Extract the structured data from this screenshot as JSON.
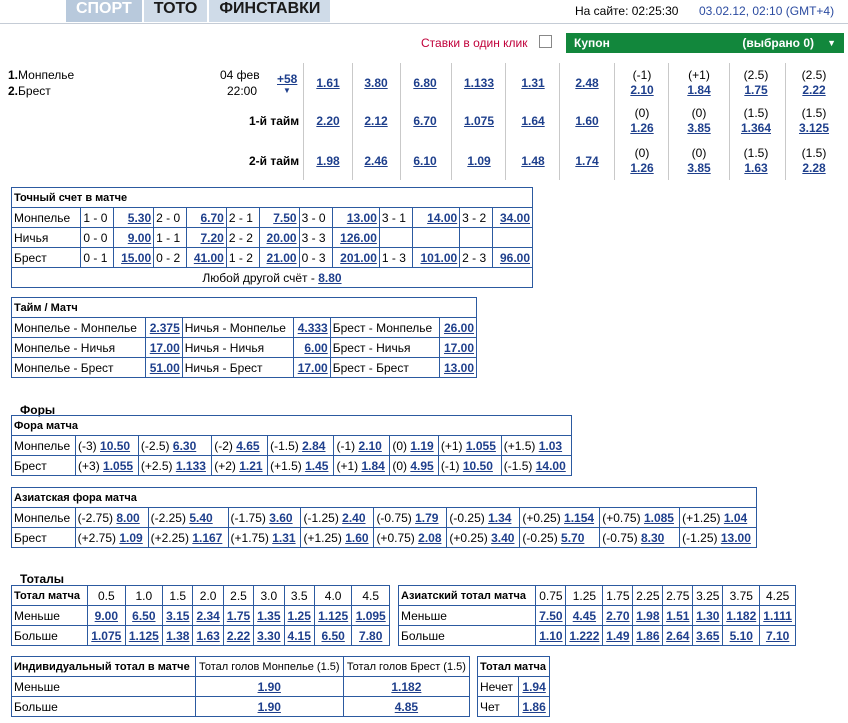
{
  "nav": {
    "items": [
      "СПОРТ",
      "ТОТО",
      "ФИНСТАВКИ"
    ]
  },
  "header": {
    "online": "На сайте: 02:25:30",
    "datetime": "03.02.12, 02:10 (GMT+4)"
  },
  "oneclick": "Ставки в один клик",
  "coupon": {
    "label": "Купон",
    "selected": "(выбрано 0)",
    "arrow": "▼"
  },
  "match": {
    "team1": "Монпелье",
    "team2": "Брест",
    "n1": "1.",
    "n2": "2.",
    "date": "04 фев",
    "time": "22:00",
    "more": "+58",
    "more_arrow": "▼",
    "rows": [
      {
        "label": "",
        "odds": [
          "1.61",
          "3.80",
          "6.80",
          "1.133",
          "1.31",
          "2.48"
        ],
        "h": [
          [
            "(-1)",
            "2.10"
          ],
          [
            "(+1)",
            "1.84"
          ],
          [
            "(2.5)",
            "1.75"
          ],
          [
            "(2.5)",
            "2.22"
          ]
        ]
      },
      {
        "label": "1-й тайм",
        "odds": [
          "2.20",
          "2.12",
          "6.70",
          "1.075",
          "1.64",
          "1.60"
        ],
        "h": [
          [
            "(0)",
            "1.26"
          ],
          [
            "(0)",
            "3.85"
          ],
          [
            "(1.5)",
            "1.364"
          ],
          [
            "(1.5)",
            "3.125"
          ]
        ]
      },
      {
        "label": "2-й тайм",
        "odds": [
          "1.98",
          "2.46",
          "6.10",
          "1.09",
          "1.48",
          "1.74"
        ],
        "h": [
          [
            "(0)",
            "1.26"
          ],
          [
            "(0)",
            "3.85"
          ],
          [
            "(1.5)",
            "1.63"
          ],
          [
            "(1.5)",
            "2.28"
          ]
        ]
      }
    ]
  },
  "exact": {
    "title": "Точный счет в матче",
    "rows": [
      [
        "Монпелье",
        "1 - 0",
        "5.30",
        "2 - 0",
        "6.70",
        "2 - 1",
        "7.50",
        "3 - 0",
        "13.00",
        "3 - 1",
        "14.00",
        "3 - 2",
        "34.00"
      ],
      [
        "Ничья",
        "0 - 0",
        "9.00",
        "1 - 1",
        "7.20",
        "2 - 2",
        "20.00",
        "3 - 3",
        "126.00",
        "",
        "",
        "",
        ""
      ],
      [
        "Брест",
        "0 - 1",
        "15.00",
        "0 - 2",
        "41.00",
        "1 - 2",
        "21.00",
        "0 - 3",
        "201.00",
        "1 - 3",
        "101.00",
        "2 - 3",
        "96.00"
      ]
    ],
    "other_label": "Любой другой счёт - ",
    "other_odd": "8.80"
  },
  "htft": {
    "title": "Тайм / Матч",
    "rows": [
      [
        "Монпелье - Монпелье",
        "2.375",
        "Ничья - Монпелье",
        "4.333",
        "Брест - Монпелье",
        "26.00"
      ],
      [
        "Монпелье - Ничья",
        "17.00",
        "Ничья - Ничья",
        "6.00",
        "Брест - Ничья",
        "17.00"
      ],
      [
        "Монпелье - Брест",
        "51.00",
        "Ничья - Брест",
        "17.00",
        "Брест - Брест",
        "13.00"
      ]
    ]
  },
  "handicaps_title": "Форы",
  "fora": {
    "title": "Фора матча",
    "rows": [
      [
        "Монпелье",
        [
          "(-3)",
          "10.50"
        ],
        [
          "(-2.5)",
          "6.30"
        ],
        [
          "(-2)",
          "4.65"
        ],
        [
          "(-1.5)",
          "2.84"
        ],
        [
          "(-1)",
          "2.10"
        ],
        [
          "(0)",
          "1.19"
        ],
        [
          "(+1)",
          "1.055"
        ],
        [
          "(+1.5)",
          "1.03"
        ]
      ],
      [
        "Брест",
        [
          "(+3)",
          "1.055"
        ],
        [
          "(+2.5)",
          "1.133"
        ],
        [
          "(+2)",
          "1.21"
        ],
        [
          "(+1.5)",
          "1.45"
        ],
        [
          "(+1)",
          "1.84"
        ],
        [
          "(0)",
          "4.95"
        ],
        [
          "(-1)",
          "10.50"
        ],
        [
          "(-1.5)",
          "14.00"
        ]
      ]
    ]
  },
  "asian": {
    "title": "Азиатская фора матча",
    "rows": [
      [
        "Монпелье",
        [
          "(-2.75)",
          "8.00"
        ],
        [
          "(-2.25)",
          "5.40"
        ],
        [
          "(-1.75)",
          "3.60"
        ],
        [
          "(-1.25)",
          "2.40"
        ],
        [
          "(-0.75)",
          "1.79"
        ],
        [
          "(-0.25)",
          "1.34"
        ],
        [
          "(+0.25)",
          "1.154"
        ],
        [
          "(+0.75)",
          "1.085"
        ],
        [
          "(+1.25)",
          "1.04"
        ]
      ],
      [
        "Брест",
        [
          "(+2.75)",
          "1.09"
        ],
        [
          "(+2.25)",
          "1.167"
        ],
        [
          "(+1.75)",
          "1.31"
        ],
        [
          "(+1.25)",
          "1.60"
        ],
        [
          "(+0.75)",
          "2.08"
        ],
        [
          "(+0.25)",
          "3.40"
        ],
        [
          "(-0.25)",
          "5.70"
        ],
        [
          "(-0.75)",
          "8.30"
        ],
        [
          "(-1.25)",
          "13.00"
        ]
      ]
    ]
  },
  "totals_title": "Тоталы",
  "total": {
    "title": "Тотал матча",
    "heads": [
      "0.5",
      "1.0",
      "1.5",
      "2.0",
      "2.5",
      "3.0",
      "3.5",
      "4.0",
      "4.5"
    ],
    "rows": [
      [
        "Меньше",
        "9.00",
        "6.50",
        "3.15",
        "2.34",
        "1.75",
        "1.35",
        "1.25",
        "1.125",
        "1.095"
      ],
      [
        "Больше",
        "1.075",
        "1.125",
        "1.38",
        "1.63",
        "2.22",
        "3.30",
        "4.15",
        "6.50",
        "7.80"
      ]
    ]
  },
  "atotal": {
    "title": "Азиатский тотал матча",
    "heads": [
      "0.75",
      "1.25",
      "1.75",
      "2.25",
      "2.75",
      "3.25",
      "3.75",
      "4.25"
    ],
    "rows": [
      [
        "Меньше",
        "7.50",
        "4.45",
        "2.70",
        "1.98",
        "1.51",
        "1.30",
        "1.182",
        "1.111"
      ],
      [
        "Больше",
        "1.10",
        "1.222",
        "1.49",
        "1.86",
        "2.64",
        "3.65",
        "5.10",
        "7.10"
      ]
    ]
  },
  "ind": {
    "title": "Индивидуальный тотал в матче",
    "h1": "Тотал голов Монпелье (1.5)",
    "h2": "Тотал голов Брест (1.5)",
    "rows": [
      [
        "Меньше",
        "1.90",
        "1.182"
      ],
      [
        "Больше",
        "1.90",
        "4.85"
      ]
    ]
  },
  "oddeven": {
    "title": "Тотал матча",
    "rows": [
      [
        "Нечет",
        "1.94"
      ],
      [
        "Чет",
        "1.86"
      ]
    ]
  }
}
